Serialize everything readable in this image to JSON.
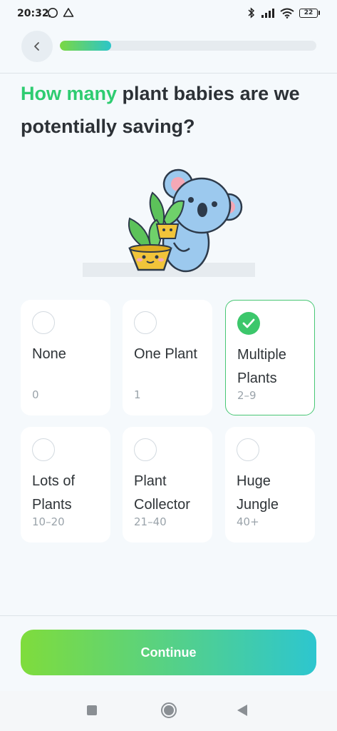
{
  "status": {
    "time": "20:32",
    "battery": "22"
  },
  "progress": {
    "value_percent": 20
  },
  "question": {
    "accent": "How many",
    "rest": " plant babies are we potentially saving?"
  },
  "options": [
    {
      "label": "None",
      "range": "0",
      "selected": false
    },
    {
      "label": "One Plant",
      "range": "1",
      "selected": false
    },
    {
      "label": "Multiple Plants",
      "range": "2–9",
      "selected": true
    },
    {
      "label": "Lots of Plants",
      "range": "10–20",
      "selected": false
    },
    {
      "label": "Plant Collector",
      "range": "21–40",
      "selected": false
    },
    {
      "label": "Huge Jungle",
      "range": "40+",
      "selected": false
    }
  ],
  "continue_label": "Continue",
  "colors": {
    "accent": "#2ecc71",
    "gradient_start": "#7fdc3c",
    "gradient_end": "#2dc6cf",
    "selected_border": "#48c774"
  },
  "icons": [
    "whatsapp-icon",
    "drive-icon",
    "bluetooth-icon",
    "signal-icon",
    "wifi-icon",
    "battery-icon",
    "back-chevron-icon",
    "checkmark-icon",
    "koala-plant-illustration"
  ]
}
